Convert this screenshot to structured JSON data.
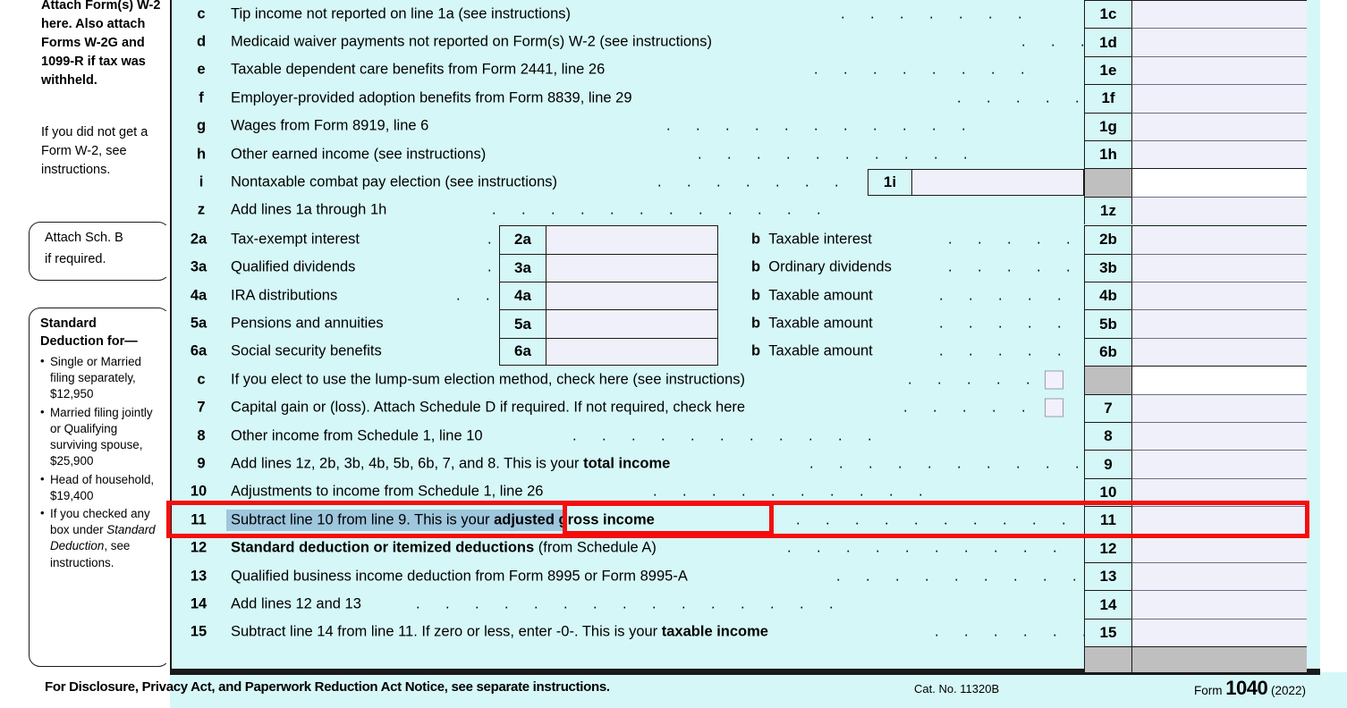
{
  "margin": {
    "attach_note_bold": "Attach Form(s) W-2 here. Also attach Forms W-2G and 1099-R if tax was withheld.",
    "attach_note_plain": "If you did not get a Form W-2, see instructions.",
    "sch_b_line1": "Attach Sch. B",
    "sch_b_line2": "if required.",
    "std_deduction_title": "Standard Deduction for—",
    "std_deduction_items": [
      "Single or Married filing separately, $12,950",
      "Married filing jointly or Qualifying surviving spouse, $25,900",
      "Head of household, $19,400",
      "If you checked any box under Standard Deduction, see instructions."
    ]
  },
  "rows": [
    {
      "code": "c",
      "text": "Tip income not reported on line 1a (see instructions)",
      "num": "1c"
    },
    {
      "code": "d",
      "text": "Medicaid waiver payments not reported on Form(s) W-2 (see instructions)",
      "num": "1d"
    },
    {
      "code": "e",
      "text": "Taxable dependent care benefits from Form 2441, line 26",
      "num": "1e"
    },
    {
      "code": "f",
      "text": "Employer-provided adoption benefits from Form 8839, line 29",
      "num": "1f"
    },
    {
      "code": "g",
      "text": "Wages from Form 8919, line 6",
      "num": "1g"
    },
    {
      "code": "h",
      "text": "Other earned income (see instructions)",
      "num": "1h"
    },
    {
      "code": "i",
      "text": "Nontaxable combat pay election (see instructions)",
      "num": "",
      "inline_box": "1i"
    },
    {
      "code": "z",
      "text": "Add lines 1a through 1h",
      "num": "1z"
    }
  ],
  "ab_rows": [
    {
      "acode": "2a",
      "atext": "Tax-exempt interest",
      "abox": "2a",
      "bcode": "b",
      "btext": "Taxable interest",
      "num": "2b"
    },
    {
      "acode": "3a",
      "atext": "Qualified dividends",
      "abox": "3a",
      "bcode": "b",
      "btext": "Ordinary dividends",
      "num": "3b"
    },
    {
      "acode": "4a",
      "atext": "IRA distributions",
      "abox": "4a",
      "bcode": "b",
      "btext": "Taxable amount",
      "num": "4b"
    },
    {
      "acode": "5a",
      "atext": "Pensions and annuities",
      "abox": "5a",
      "bcode": "b",
      "btext": "Taxable amount",
      "num": "5b"
    },
    {
      "acode": "6a",
      "atext": "Social security benefits",
      "abox": "6a",
      "bcode": "b",
      "btext": "Taxable amount",
      "num": "6b"
    }
  ],
  "rows2": [
    {
      "code": "c",
      "text": "If you elect to use the lump-sum election method, check here (see instructions)",
      "num": "",
      "checkbox": true
    },
    {
      "code": "7",
      "text": "Capital gain or (loss). Attach Schedule D if required. If not required, check here",
      "num": "7",
      "checkbox": true
    },
    {
      "code": "8",
      "text": "Other income from Schedule 1, line 10",
      "num": "8"
    },
    {
      "code": "9",
      "text": "Add lines 1z, 2b, 3b, 4b, 5b, 6b, 7, and 8. This is your ",
      "bold": "total income",
      "num": "9"
    },
    {
      "code": "10",
      "text": "Adjustments to income from Schedule 1, line 26",
      "num": "10"
    },
    {
      "code": "11",
      "text": "Subtract line 10 from line 9. This is your ",
      "bold": "adjusted gross income",
      "num": "11",
      "highlighted": true
    },
    {
      "code": "12",
      "boldlead": "Standard deduction or itemized deductions",
      "text": " (from Schedule A)",
      "num": "12"
    },
    {
      "code": "13",
      "text": "Qualified business income deduction from Form 8995 or Form 8995-A",
      "num": "13"
    },
    {
      "code": "14",
      "text": "Add lines 12 and 13",
      "num": "14"
    },
    {
      "code": "15",
      "text": "Subtract line 14 from line 11. If zero or less, enter -0-. This is your ",
      "bold": "taxable income",
      "num": "15"
    }
  ],
  "footer": {
    "disclosure": "For Disclosure, Privacy Act, and Paperwork Reduction Act Notice, see separate instructions.",
    "cat_no": "Cat. No. 11320B",
    "form_label": "Form",
    "form_number": "1040",
    "form_year": "(2022)"
  },
  "annotation": {
    "highlight_color": "#9ec6dd",
    "redbox_color": "#f50d0d",
    "selected_text": "Subtract line 10 from line 9. This is your",
    "boxed_text": "adjusted gross income"
  },
  "colors": {
    "form_background": "#d6f7f7",
    "amount_field": "#eff0fa",
    "gray_cell": "#bfbfbf",
    "rule": "#1a1a1a"
  }
}
